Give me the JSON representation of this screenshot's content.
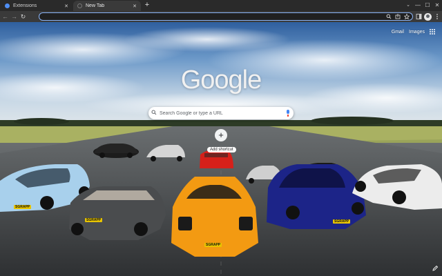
{
  "tabs": [
    {
      "title": "Extensions",
      "active": false,
      "favicon": "puzzle-icon"
    },
    {
      "title": "New Tab",
      "active": true,
      "favicon": "blank-icon"
    }
  ],
  "new_tab_symbol": "+",
  "window_controls": {
    "search_tabs": "⌄",
    "minimize": "—",
    "maximize": "☐",
    "close": "✕"
  },
  "toolbar": {
    "back": "←",
    "forward": "→",
    "reload": "↻"
  },
  "omnibox": {
    "value": "",
    "placeholder": ""
  },
  "omnibox_icons": [
    "search-icon",
    "share-icon",
    "star-icon"
  ],
  "ntp": {
    "links": {
      "gmail": "Gmail",
      "images": "Images"
    },
    "logo": "Google",
    "search_placeholder": "Search Google or type a URL",
    "shortcut": {
      "icon": "+",
      "label": "Add shortcut"
    },
    "plate_text": "SGRAPP"
  },
  "colors": {
    "omnibox_border": "#8ab4f8",
    "tab_active": "#3a3a3a",
    "chrome_bg": "#2a2a2a"
  }
}
